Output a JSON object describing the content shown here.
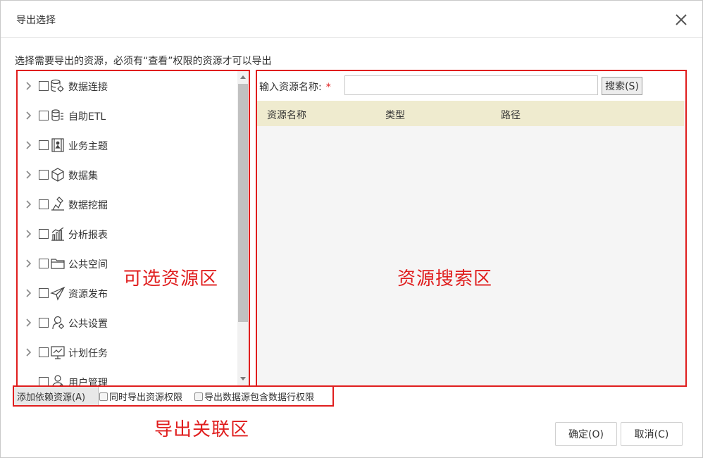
{
  "dialog": {
    "title": "导出选择",
    "description": "选择需要导出的资源，必须有“查看”权限的资源才可以导出"
  },
  "tree": {
    "items": [
      {
        "label": "数据连接",
        "icon": "database-gear-icon",
        "expandable": true
      },
      {
        "label": "自助ETL",
        "icon": "etl-icon",
        "expandable": true
      },
      {
        "label": "业务主题",
        "icon": "business-theme-icon",
        "expandable": true
      },
      {
        "label": "数据集",
        "icon": "cube-icon",
        "expandable": true
      },
      {
        "label": "数据挖掘",
        "icon": "mining-icon",
        "expandable": true
      },
      {
        "label": "分析报表",
        "icon": "bar-chart-icon",
        "expandable": true
      },
      {
        "label": "公共空间",
        "icon": "folder-icon",
        "expandable": true
      },
      {
        "label": "资源发布",
        "icon": "paper-plane-icon",
        "expandable": true
      },
      {
        "label": "公共设置",
        "icon": "settings-icon",
        "expandable": true
      },
      {
        "label": "计划任务",
        "icon": "schedule-icon",
        "expandable": true
      },
      {
        "label": "用户管理",
        "icon": "user-icon",
        "expandable": false
      }
    ]
  },
  "zones": {
    "selectable": "可选资源区",
    "search": "资源搜索区",
    "export_related": "导出关联区"
  },
  "search": {
    "label": "输入资源名称:",
    "required_mark": "*",
    "value": "",
    "button_label": "搜索(S)"
  },
  "table": {
    "columns": [
      "资源名称",
      "类型",
      "路径"
    ],
    "rows": []
  },
  "options": {
    "add_dependency_label": "添加依赖资源(A)",
    "export_permissions_label": "同时导出资源权限",
    "export_row_permissions_label": "导出数据源包含数据行权限",
    "export_permissions_checked": false,
    "export_row_permissions_checked": false
  },
  "footer": {
    "ok_label": "确定(O)",
    "cancel_label": "取消(C)"
  },
  "colors": {
    "annotation_red": "#e01e1e",
    "table_header_bg": "#efebcf"
  }
}
